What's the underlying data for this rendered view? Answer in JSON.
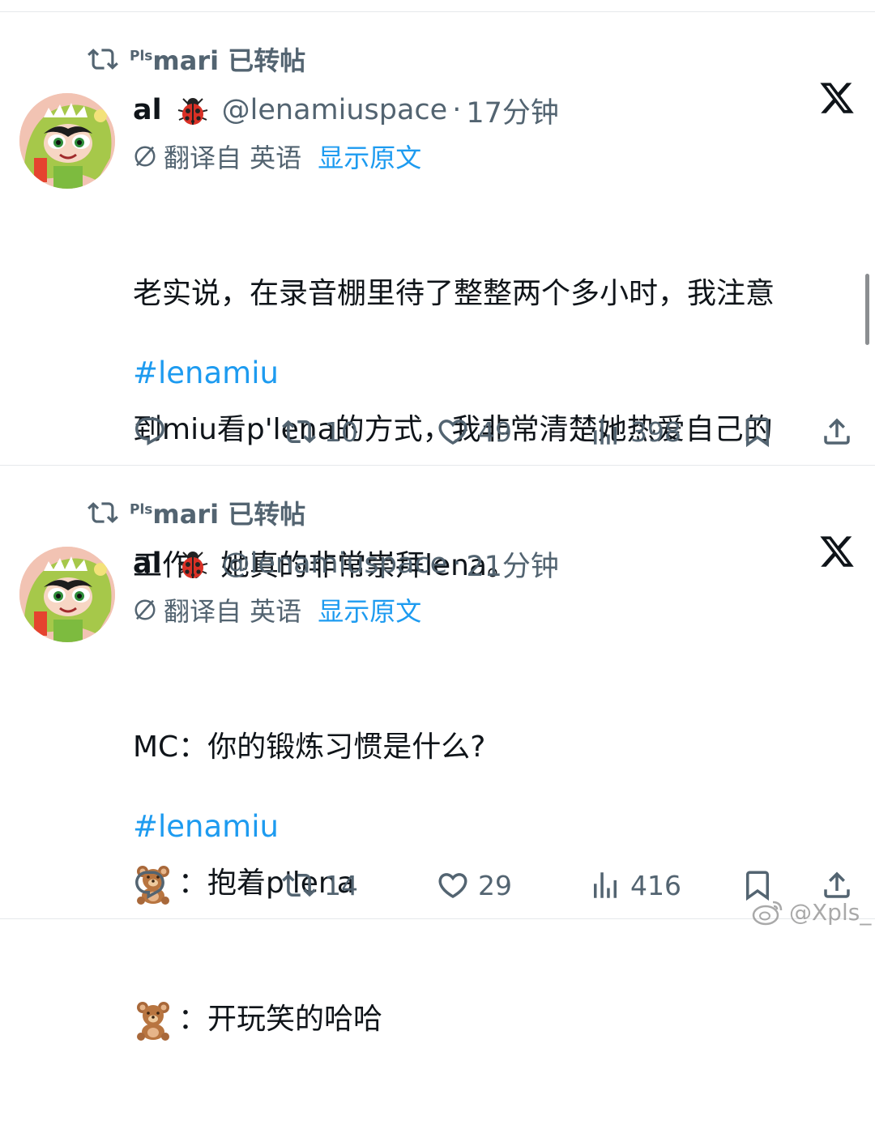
{
  "posts": [
    {
      "repost_user_prefix": "Pls",
      "repost_user": "mari",
      "repost_label": "已转帖",
      "display_name": "al",
      "handle": "@lenamiuspace",
      "separator": "·",
      "time": "17分钟",
      "translate_label": "翻译自 英语",
      "show_original": "显示原文",
      "lines": [
        "老实说，在录音棚里待了整整两个多小时，我注意",
        "到miu看p'lena的方式，我非常清楚她热爱自己的",
        "工作，她真的非常崇拜lena。"
      ],
      "hashtag": "#lenamiu",
      "replies": "",
      "reposts": "10",
      "likes": "49",
      "views": "398"
    },
    {
      "repost_user_prefix": "Pls",
      "repost_user": "mari",
      "repost_label": "已转帖",
      "display_name": "al",
      "handle": "@lenamiuspace",
      "separator": "·",
      "time": "21分钟",
      "translate_label": "翻译自 英语",
      "show_original": "显示原文",
      "lines": [
        "MC：你的锻炼习惯是什么?",
        "：抱着p'lena",
        "：开玩笑的哈哈"
      ],
      "hashtag": "#lenamiu",
      "replies": "",
      "reposts": "14",
      "likes": "29",
      "views": "416"
    }
  ],
  "icons": {
    "repost": "repost-icon",
    "ladybug": "ladybug-emoji",
    "x_logo": "x-logo-icon",
    "translate": "translate-icon",
    "reply": "reply-icon",
    "like": "heart-icon",
    "views": "views-icon",
    "bookmark": "bookmark-icon",
    "share": "share-icon",
    "bear": "teddy-bear-emoji"
  },
  "colors": {
    "link": "#1d9bf0",
    "muted": "#536471",
    "text": "#0f1419",
    "divider": "#e6e8eb"
  },
  "watermark": "@Xpls_"
}
